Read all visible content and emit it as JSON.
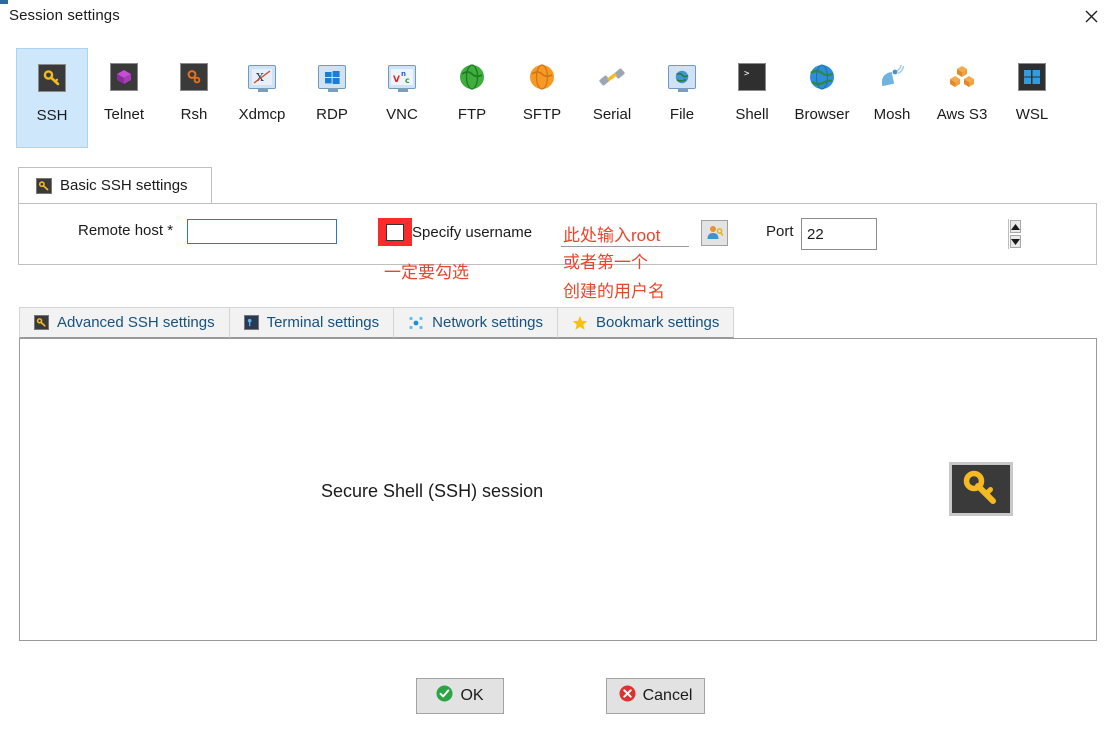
{
  "window": {
    "title": "Session settings",
    "close_icon": "close-icon"
  },
  "protocols": [
    {
      "label": "SSH",
      "icon": "ssh-key-icon",
      "selected": true
    },
    {
      "label": "Telnet",
      "icon": "telnet-cube-icon",
      "selected": false
    },
    {
      "label": "Rsh",
      "icon": "rsh-gears-icon",
      "selected": false
    },
    {
      "label": "Xdmcp",
      "icon": "xdmcp-monitor-icon",
      "selected": false
    },
    {
      "label": "RDP",
      "icon": "rdp-windows-icon",
      "selected": false
    },
    {
      "label": "VNC",
      "icon": "vnc-monitor-icon",
      "selected": false
    },
    {
      "label": "FTP",
      "icon": "ftp-green-globe-icon",
      "selected": false
    },
    {
      "label": "SFTP",
      "icon": "sftp-orange-globe-icon",
      "selected": false
    },
    {
      "label": "Serial",
      "icon": "serial-plug-icon",
      "selected": false
    },
    {
      "label": "File",
      "icon": "file-globe-monitor-icon",
      "selected": false
    },
    {
      "label": "Shell",
      "icon": "shell-terminal-icon",
      "selected": false
    },
    {
      "label": "Browser",
      "icon": "browser-globe-icon",
      "selected": false
    },
    {
      "label": "Mosh",
      "icon": "mosh-satellite-icon",
      "selected": false
    },
    {
      "label": "Aws S3",
      "icon": "aws-s3-cubes-icon",
      "selected": false
    },
    {
      "label": "WSL",
      "icon": "wsl-windows-icon",
      "selected": false
    }
  ],
  "basic": {
    "tab_label": "Basic SSH settings",
    "tab_icon": "ssh-key-icon",
    "remote_host_label": "Remote host *",
    "remote_host_value": "",
    "remote_host_placeholder": "",
    "specify_username_label": "Specify username",
    "specify_username_checked": false,
    "username_value": "此处输入root",
    "username_browse_icon": "user-key-icon",
    "port_label": "Port",
    "port_value": "22",
    "spinner_up_icon": "spinner-up-icon",
    "spinner_down_icon": "spinner-down-icon"
  },
  "annotations": {
    "color": "#e8452c",
    "checkbox_note": "一定要勾选",
    "username_note_line1": "或者第一个",
    "username_note_line2": "创建的用户名"
  },
  "sub_tabs": [
    {
      "label": "Advanced SSH settings",
      "icon": "ssh-key-icon"
    },
    {
      "label": "Terminal settings",
      "icon": "terminal-icon"
    },
    {
      "label": "Network settings",
      "icon": "network-nodes-icon"
    },
    {
      "label": "Bookmark settings",
      "icon": "star-icon"
    }
  ],
  "main_panel": {
    "caption": "Secure Shell (SSH) session",
    "icon": "ssh-key-icon"
  },
  "footer": {
    "ok_label": "OK",
    "ok_icon": "check-circle-icon",
    "cancel_label": "Cancel",
    "cancel_icon": "cross-circle-icon"
  },
  "colors": {
    "selection": "#cfe7fb",
    "focus_border": "#2b7bbb",
    "annotation_red": "#e8452c",
    "highlight_red": "#fb2b2b",
    "tab_text_blue": "#15527f"
  }
}
